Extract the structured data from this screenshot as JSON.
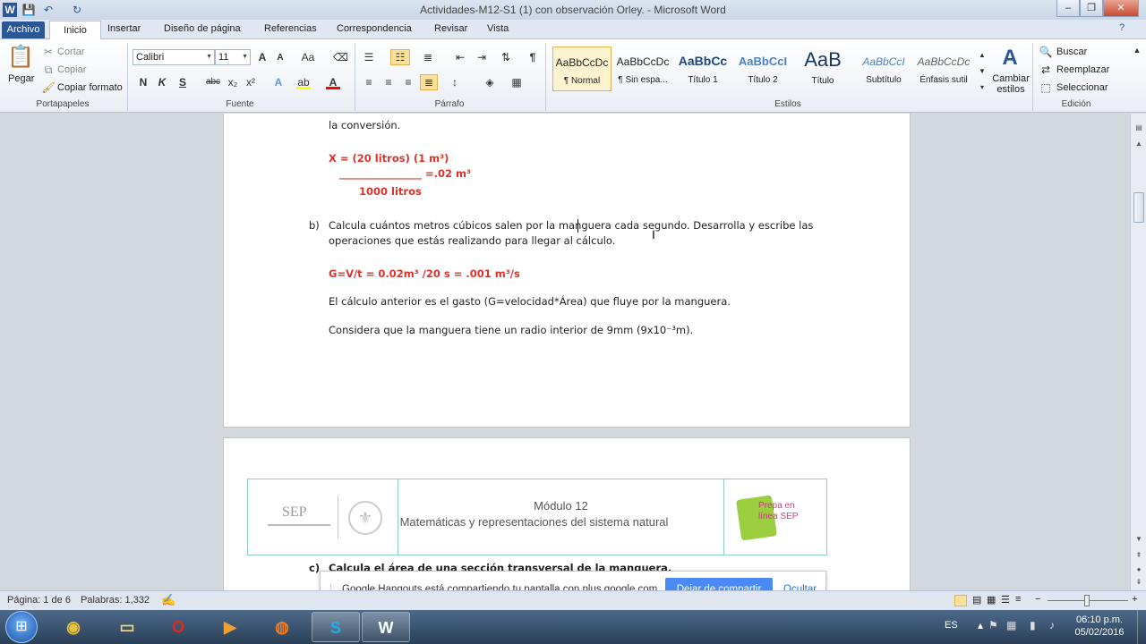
{
  "window": {
    "title": "Actividades-M12-S1 (1) con observación Orley. - Microsoft Word",
    "minimize": "–",
    "maximize": "❐",
    "close": "✕"
  },
  "quick_access": {
    "word_icon": "W",
    "save": "💾",
    "undo": "↶",
    "redo": "↻"
  },
  "tabs": [
    "Archivo",
    "Inicio",
    "Insertar",
    "Diseño de página",
    "Referencias",
    "Correspondencia",
    "Revisar",
    "Vista"
  ],
  "ribbon": {
    "clipboard": {
      "paste": "Pegar",
      "cut": "Cortar",
      "copy": "Copiar",
      "format_painter": "Copiar formato",
      "label": "Portapapeles"
    },
    "font": {
      "name": "Calibri",
      "size": "11",
      "label": "Fuente",
      "bold": "N",
      "italic": "K",
      "underline": "S",
      "strike": "abc",
      "subscript": "x₂",
      "superscript": "x²",
      "grow": "A",
      "shrink": "A",
      "case": "Aa",
      "clear": "⌫",
      "effects": "A",
      "highlight": "ab",
      "color": "A"
    },
    "paragraph": {
      "label": "Párrafo",
      "pilcrow": "¶"
    },
    "styles": {
      "label": "Estilos",
      "items": [
        {
          "sample": "AaBbCcDc",
          "name": "¶ Normal",
          "selected": true
        },
        {
          "sample": "AaBbCcDc",
          "name": "¶ Sin espa...",
          "selected": false
        },
        {
          "sample": "AaBbCc",
          "name": "Título 1",
          "selected": false
        },
        {
          "sample": "AaBbCcI",
          "name": "Título 2",
          "selected": false
        },
        {
          "sample": "AaB",
          "name": "Título",
          "selected": false
        },
        {
          "sample": "AaBbCcI",
          "name": "Subtítulo",
          "selected": false
        },
        {
          "sample": "AaBbCcDc",
          "name": "Énfasis sutil",
          "selected": false
        }
      ],
      "change": "Cambiar estilos"
    },
    "editing": {
      "label": "Edición",
      "find": "Buscar",
      "replace": "Reemplazar",
      "select": "Seleccionar"
    }
  },
  "document": {
    "line1": "la conversión.",
    "formula_top": "X = (20 litros) (1 m³)",
    "formula_line": "________________  =.02 m³",
    "formula_bottom": "1000  litros",
    "b_marker": "b)",
    "b_text_1": "Calcula  cuántos  metros  cúbicos  salen  por  la  manguera  cada  segundo.  Desarrolla  y  escribe  las",
    "b_text_2": "operaciones que estás realizando para llegar al cálculo.",
    "g_formula": "G=V/t      =    0.02m³  /20 s  = .001  m³/s",
    "gasto_text": "El cálculo anterior es el gasto (G=velocidad*Área) que fluye por la manguera.",
    "radio_text": "Considera que la manguera tiene un radio interior de 9mm (9x10⁻³m).",
    "header_logo_text": "SEP",
    "header_module": "Módulo 12",
    "header_subject": "Matemáticas y representaciones del sistema natural",
    "header_right": "Prepa en línea SEP",
    "c_marker": "c)",
    "c_text": "Calcula el área de una sección transversal de la manguera."
  },
  "hangouts": {
    "message": "Google Hangouts está compartiendo tu pantalla con plus.google.com.",
    "stop": "Dejar de compartir",
    "hide": "Ocultar"
  },
  "status": {
    "page": "Página: 1 de 6",
    "words": "Palabras: 1,332"
  },
  "taskbar": {
    "language": "ES",
    "time": "06:10 p.m.",
    "date": "05/02/2016",
    "apps": [
      "start",
      "chrome",
      "explorer",
      "opera",
      "media",
      "firefox",
      "skype",
      "word"
    ]
  },
  "colors": {
    "accent": "#2b5797",
    "red_text": "#d9342b",
    "hangouts_btn": "#4a8af4"
  }
}
